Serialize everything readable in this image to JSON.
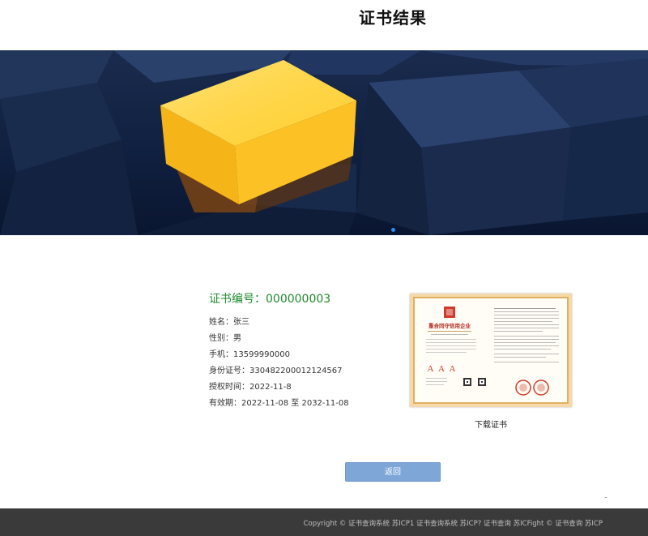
{
  "page": {
    "title": "证书结果"
  },
  "certificate": {
    "number_label": "证书编号：",
    "number_value": "000000003",
    "fields": [
      {
        "label": "姓名：",
        "value": "张三"
      },
      {
        "label": "性别：",
        "value": "男"
      },
      {
        "label": "手机：",
        "value": "13599990000"
      },
      {
        "label": "身份证号：",
        "value": "330482200012124567"
      },
      {
        "label": "授权时间：",
        "value": "2022-11-8"
      },
      {
        "label": "有效期：",
        "value": "2022-11-08 至 2032-11-08"
      }
    ],
    "image": {
      "heading": "重合同守信用企业",
      "rating": "A A A",
      "accent_color": "#d23b2b",
      "border_color": "#e0b062"
    },
    "download_label": "下载证书"
  },
  "actions": {
    "return_label": "返回"
  },
  "footer": {
    "copyright": "Copyright © 证书查询系统 苏ICP1 证书查询系统 苏ICP? 证书查询 苏ICFight © 证书查询 苏ICP"
  },
  "colors": {
    "accent": "#2d8cf0",
    "number_green": "#1f8a2e",
    "button": "#7ea7d8",
    "footer_bg": "#3a3a3a"
  }
}
